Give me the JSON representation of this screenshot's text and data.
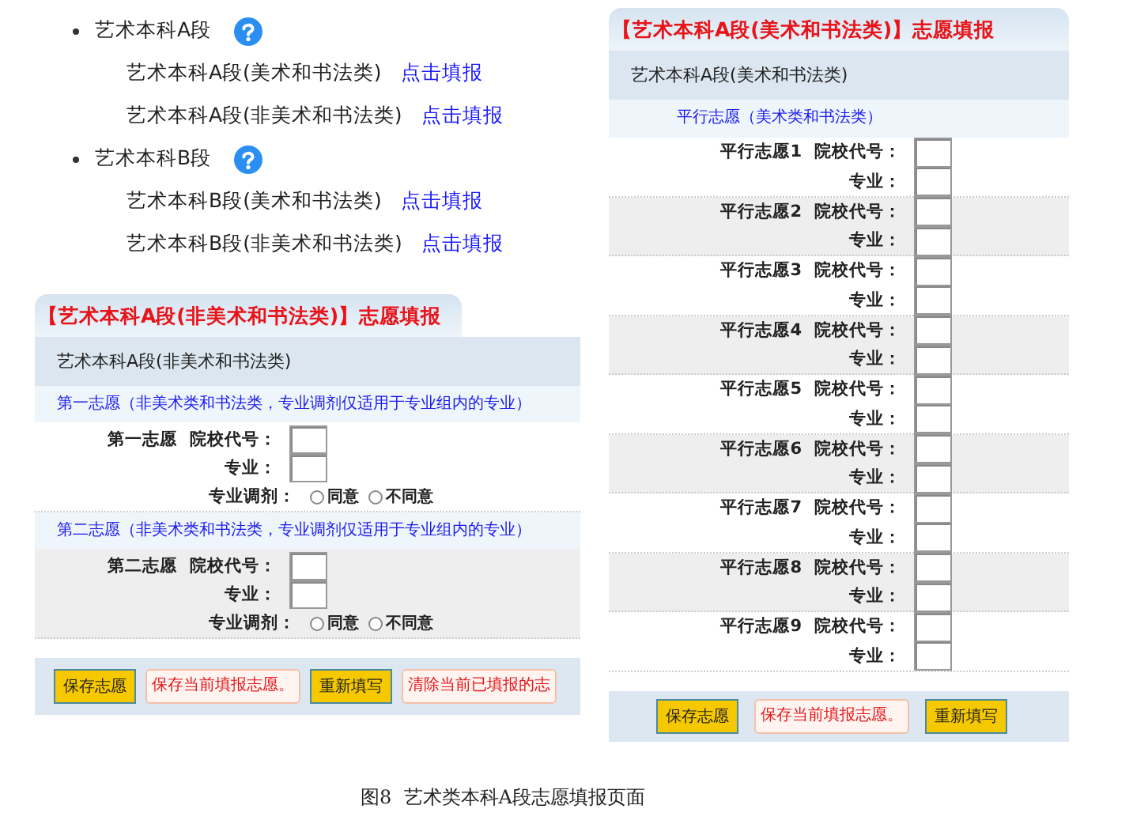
{
  "categories": [
    {
      "label": "艺术本科A段",
      "items": [
        {
          "label": "艺术本科A段(美术和书法类)",
          "link": "点击填报"
        },
        {
          "label": "艺术本科A段(非美术和书法类)",
          "link": "点击填报"
        }
      ]
    },
    {
      "label": "艺术本科B段",
      "items": [
        {
          "label": "艺术本科B段(美术和书法类)",
          "link": "点击填报"
        },
        {
          "label": "艺术本科B段(非美术和书法类)",
          "link": "点击填报"
        }
      ]
    }
  ],
  "form_nonart": {
    "tab_title": "【艺术本科A段(非美术和书法类)】志愿填报",
    "subtitle": "艺术本科A段(非美术和书法类)",
    "sections": [
      {
        "heading": "第一志愿（非美术类和书法类，专业调剂仅适用于专业组内的专业）",
        "label": "第一志愿",
        "code_label": "院校代号：",
        "major_label": "专业：",
        "adjust_label": "专业调剂：",
        "options": [
          {
            "label": "同意",
            "selected": false
          },
          {
            "label": "不同意",
            "selected": false
          }
        ]
      },
      {
        "heading": "第二志愿（非美术类和书法类，专业调剂仅适用于专业组内的专业）",
        "label": "第二志愿",
        "code_label": "院校代号：",
        "major_label": "专业：",
        "adjust_label": "专业调剂：",
        "options": [
          {
            "label": "同意",
            "selected": false
          },
          {
            "label": "不同意",
            "selected": false
          }
        ]
      }
    ],
    "actions": [
      {
        "kind": "button",
        "label": "保存志愿"
      },
      {
        "kind": "tip",
        "label": "保存当前填报志愿。"
      },
      {
        "kind": "button",
        "label": "重新填写"
      },
      {
        "kind": "tip",
        "label": "清除当前已填报的志"
      }
    ]
  },
  "form_art": {
    "tab_title": "【艺术本科A段(美术和书法类)】志愿填报",
    "subtitle": "艺术本科A段(美术和书法类)",
    "section_heading": "平行志愿（美术类和书法类）",
    "rows": [
      {
        "label": "平行志愿1",
        "code_label": "院校代号：",
        "major_label": "专业："
      },
      {
        "label": "平行志愿2",
        "code_label": "院校代号：",
        "major_label": "专业："
      },
      {
        "label": "平行志愿3",
        "code_label": "院校代号：",
        "major_label": "专业："
      },
      {
        "label": "平行志愿4",
        "code_label": "院校代号：",
        "major_label": "专业："
      },
      {
        "label": "平行志愿5",
        "code_label": "院校代号：",
        "major_label": "专业："
      },
      {
        "label": "平行志愿6",
        "code_label": "院校代号：",
        "major_label": "专业："
      },
      {
        "label": "平行志愿7",
        "code_label": "院校代号：",
        "major_label": "专业："
      },
      {
        "label": "平行志愿8",
        "code_label": "院校代号：",
        "major_label": "专业："
      },
      {
        "label": "平行志愿9",
        "code_label": "院校代号：",
        "major_label": "专业："
      }
    ],
    "actions": [
      {
        "kind": "button",
        "label": "保存志愿"
      },
      {
        "kind": "tip",
        "label": "保存当前填报志愿。"
      },
      {
        "kind": "button",
        "label": "重新填写"
      }
    ]
  },
  "caption": "图8  艺术类本科A段志愿填报页面"
}
